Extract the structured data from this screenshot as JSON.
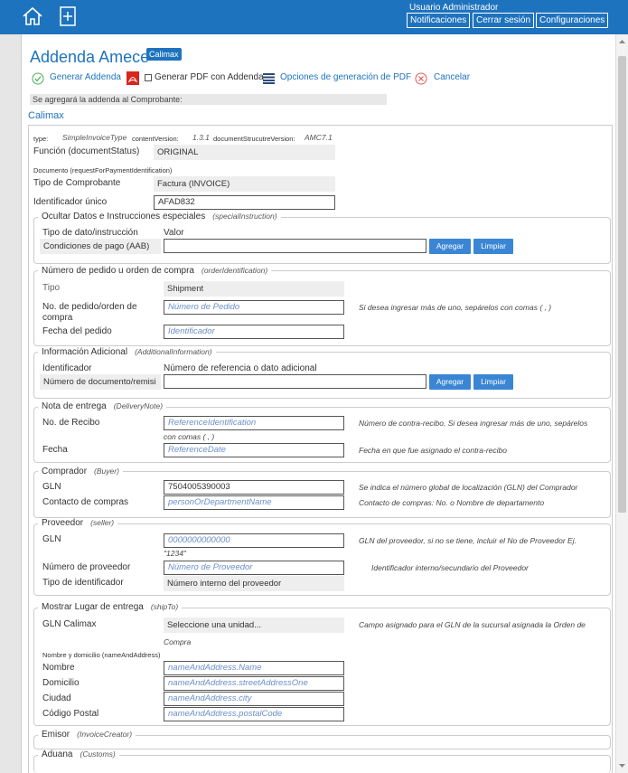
{
  "header": {
    "user": "Usuario Administrador",
    "buttons": [
      "Notificaciones",
      "Cerrar sesión",
      "Configuraciones"
    ]
  },
  "page": {
    "title": "Addenda Amece",
    "badge": "Calimax"
  },
  "toolbar": {
    "generate": "Generar Addenda",
    "pdf_checkbox": "Generar PDF con Addenda",
    "pdf_options": "Opciones de generación de PDF",
    "cancel": "Cancelar"
  },
  "notice": "Se agregará la addenda al Comprobante:",
  "section_link": "Calimax",
  "header_fields": {
    "type_label": "type:",
    "type_value": "SimpleInvoiceType",
    "content_version_label": "contentVersion:",
    "content_version_value": "1.3.1",
    "doc_structure_label": "documentStrucutreVersion:",
    "doc_structure_value": "AMC7.1",
    "funcion_label": "Función (documentStatus)",
    "funcion_value": "ORIGINAL",
    "documento_label": "Documento (requestForPaymentIdentification)",
    "tipo_comprobante_label": "Tipo de Comprobante",
    "tipo_comprobante_value": "Factura (INVOICE)",
    "identificador_label": "Identificador único",
    "identificador_value": "AFAD832"
  },
  "special": {
    "legend": "Ocultar Datos e Instrucciones especiales",
    "legend_en": "(specialInstruction)",
    "col1": "Tipo de dato/instrucción",
    "col2": "Valor",
    "select_value": "Condiciones de pago (AAB)",
    "add": "Agregar",
    "clear": "Limpiar"
  },
  "order": {
    "legend": "Número de pedido u orden de compra",
    "legend_en": "(orderIdentification)",
    "tipo_label": "Tipo",
    "tipo_value": "Shipment",
    "pedido_label_1": "No. de pedido/orden de",
    "pedido_label_2": "compra",
    "pedido_ph": "Número de Pedido",
    "pedido_help": "Si desea ingresar más de uno, sepárelos con comas ( , )",
    "fecha_label": "Fecha del pedido",
    "fecha_ph": "Identificador"
  },
  "additional": {
    "legend": "Información Adicional",
    "legend_en": "(AdditionalInformation)",
    "col1": "Identificador",
    "col2": "Número de referencia o dato adicional",
    "select_value": "Número de documento/remisi",
    "add": "Agregar",
    "clear": "Limpiar"
  },
  "delivery": {
    "legend": "Nota de entrega",
    "legend_en": "(DeliveryNote)",
    "recibo_label": "No. de Recibo",
    "recibo_ph": "ReferenceIdentification",
    "recibo_help": "Número de contra-recibo. Si desea ingresar más de uno, sepárelos",
    "recibo_help2": "con comas ( , )",
    "fecha_label": "Fecha",
    "fecha_ph": "ReferenceDate",
    "fecha_help": "Fecha en que fue asignado el contra-recibo"
  },
  "buyer": {
    "legend": "Comprador",
    "legend_en": "(Buyer)",
    "gln_label": "GLN",
    "gln_value": "7504005390003",
    "gln_help": "Se indica el número global de localización (GLN) del Comprador",
    "contact_label": "Contacto de compras",
    "contact_ph": "personOrDepartmentName",
    "contact_help": "Contacto de compras: No. o Nombre de departamento"
  },
  "seller": {
    "legend": "Proveedor",
    "legend_en": "(seller)",
    "gln_label": "GLN",
    "gln_ph": "0000000000000",
    "gln_help": "GLN del proveedor, si no se tiene, incluir el No de Proveedor Ej.",
    "gln_help2": "\"1234\"",
    "num_label": "Número de proveedor",
    "num_ph": "Número de Proveedor",
    "num_help": "Identificador interno/secundario del Proveedor",
    "tipo_label": "Tipo de identificador",
    "tipo_value": "Número interno del proveedor"
  },
  "shipto": {
    "legend": "Mostrar Lugar de entrega",
    "legend_en": "(shipTo)",
    "gln_label": "GLN Calimax",
    "gln_select": "Seleccione una unidad...",
    "gln_help": "Campo asignado para el GLN de la sucursal asignada la Orden de",
    "gln_help2": "Compra",
    "name_address": "Nombre y domicilio (nameAndAddress)",
    "nombre_label": "Nombre",
    "nombre_ph": "nameAndAddress.Name",
    "domicilio_label": "Domicilio",
    "domicilio_ph": "nameAndAddress.streetAddressOne",
    "ciudad_label": "Ciudad",
    "ciudad_ph": "nameAndAddress.city",
    "cp_label": "Código Postal",
    "cp_ph": "nameAndAddress.postalCode"
  },
  "emisor": {
    "legend": "Emisor",
    "legend_en": "(InvoiceCreator)"
  },
  "aduana": {
    "legend": "Aduana",
    "legend_en": "(Customs)"
  },
  "colors": {
    "accent": "#1e73be",
    "button": "#3b86d4",
    "placeholder": "#6a8fc7"
  }
}
